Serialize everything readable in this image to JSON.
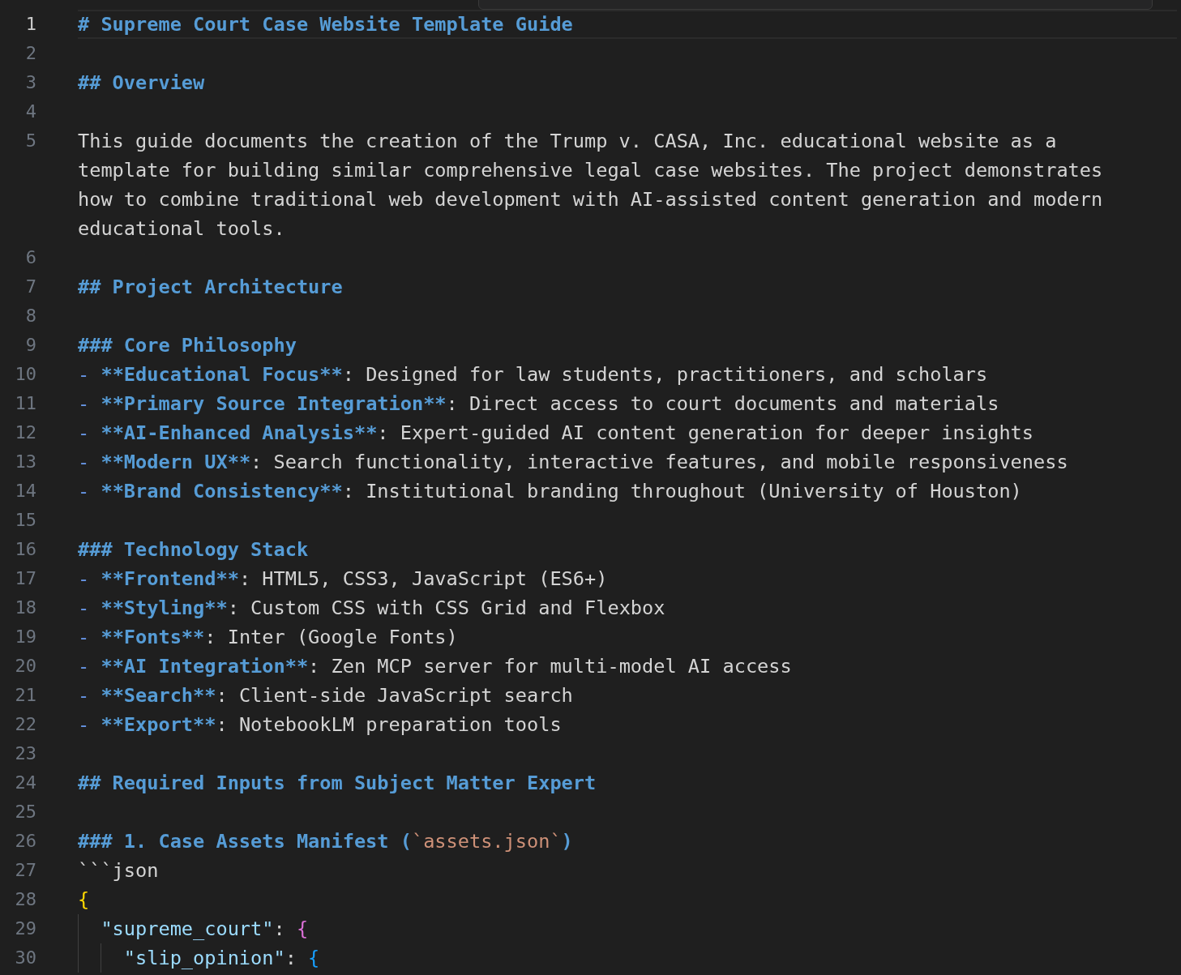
{
  "editor": {
    "lines": [
      {
        "number": "1",
        "current": true,
        "tokens": [
          {
            "kind": "heading",
            "text": "# Supreme Court Case Website Template Guide"
          }
        ]
      },
      {
        "number": "2",
        "current": false
      },
      {
        "number": "3",
        "current": false,
        "tokens": [
          {
            "kind": "heading",
            "text": "## Overview"
          }
        ]
      },
      {
        "number": "4",
        "current": false
      },
      {
        "number": "5",
        "current": false,
        "tokens": [
          {
            "kind": "plain",
            "text": "This guide documents the creation of the Trump v. CASA, Inc. educational website as a template for building similar comprehensive legal case websites. The project demonstrates how to combine traditional web development with AI-assisted content generation and modern educational tools."
          }
        ]
      },
      {
        "number": "6",
        "current": false
      },
      {
        "number": "7",
        "current": false,
        "tokens": [
          {
            "kind": "heading",
            "text": "## Project Architecture"
          }
        ]
      },
      {
        "number": "8",
        "current": false
      },
      {
        "number": "9",
        "current": false,
        "tokens": [
          {
            "kind": "heading",
            "text": "### Core Philosophy"
          }
        ]
      },
      {
        "number": "10",
        "current": false,
        "tokens": [
          {
            "kind": "bullet",
            "text": "- "
          },
          {
            "kind": "strong",
            "text": "**Educational Focus**"
          },
          {
            "kind": "plain",
            "text": ": Designed for law students, practitioners, and scholars"
          }
        ]
      },
      {
        "number": "11",
        "current": false,
        "tokens": [
          {
            "kind": "bullet",
            "text": "- "
          },
          {
            "kind": "strong",
            "text": "**Primary Source Integration**"
          },
          {
            "kind": "plain",
            "text": ": Direct access to court documents and materials"
          }
        ]
      },
      {
        "number": "12",
        "current": false,
        "tokens": [
          {
            "kind": "bullet",
            "text": "- "
          },
          {
            "kind": "strong",
            "text": "**AI-Enhanced Analysis**"
          },
          {
            "kind": "plain",
            "text": ": Expert-guided AI content generation for deeper insights"
          }
        ]
      },
      {
        "number": "13",
        "current": false,
        "tokens": [
          {
            "kind": "bullet",
            "text": "- "
          },
          {
            "kind": "strong",
            "text": "**Modern UX**"
          },
          {
            "kind": "plain",
            "text": ": Search functionality, interactive features, and mobile responsiveness"
          }
        ]
      },
      {
        "number": "14",
        "current": false,
        "tokens": [
          {
            "kind": "bullet",
            "text": "- "
          },
          {
            "kind": "strong",
            "text": "**Brand Consistency**"
          },
          {
            "kind": "plain",
            "text": ": Institutional branding throughout (University of Houston)"
          }
        ]
      },
      {
        "number": "15",
        "current": false
      },
      {
        "number": "16",
        "current": false,
        "tokens": [
          {
            "kind": "heading",
            "text": "### Technology Stack"
          }
        ]
      },
      {
        "number": "17",
        "current": false,
        "tokens": [
          {
            "kind": "bullet",
            "text": "- "
          },
          {
            "kind": "strong",
            "text": "**Frontend**"
          },
          {
            "kind": "plain",
            "text": ": HTML5, CSS3, JavaScript (ES6+)"
          }
        ]
      },
      {
        "number": "18",
        "current": false,
        "tokens": [
          {
            "kind": "bullet",
            "text": "- "
          },
          {
            "kind": "strong",
            "text": "**Styling**"
          },
          {
            "kind": "plain",
            "text": ": Custom CSS with CSS Grid and Flexbox"
          }
        ]
      },
      {
        "number": "19",
        "current": false,
        "tokens": [
          {
            "kind": "bullet",
            "text": "- "
          },
          {
            "kind": "strong",
            "text": "**Fonts**"
          },
          {
            "kind": "plain",
            "text": ": Inter (Google Fonts)"
          }
        ]
      },
      {
        "number": "20",
        "current": false,
        "tokens": [
          {
            "kind": "bullet",
            "text": "- "
          },
          {
            "kind": "strong",
            "text": "**AI Integration**"
          },
          {
            "kind": "plain",
            "text": ": Zen MCP server for multi-model AI access"
          }
        ]
      },
      {
        "number": "21",
        "current": false,
        "tokens": [
          {
            "kind": "bullet",
            "text": "- "
          },
          {
            "kind": "strong",
            "text": "**Search**"
          },
          {
            "kind": "plain",
            "text": ": Client-side JavaScript search"
          }
        ]
      },
      {
        "number": "22",
        "current": false,
        "tokens": [
          {
            "kind": "bullet",
            "text": "- "
          },
          {
            "kind": "strong",
            "text": "**Export**"
          },
          {
            "kind": "plain",
            "text": ": NotebookLM preparation tools"
          }
        ]
      },
      {
        "number": "23",
        "current": false
      },
      {
        "number": "24",
        "current": false,
        "tokens": [
          {
            "kind": "heading",
            "text": "## Required Inputs from Subject Matter Expert"
          }
        ]
      },
      {
        "number": "25",
        "current": false
      },
      {
        "number": "26",
        "current": false,
        "tokens": [
          {
            "kind": "heading",
            "text": "### 1. Case Assets Manifest ("
          },
          {
            "kind": "code",
            "text": "`assets.json`"
          },
          {
            "kind": "heading",
            "text": ")"
          }
        ]
      },
      {
        "number": "27",
        "current": false,
        "tokens": [
          {
            "kind": "plain",
            "text": "```json"
          }
        ]
      },
      {
        "number": "28",
        "current": false,
        "tokens": [
          {
            "kind": "bracket1",
            "text": "{"
          }
        ]
      },
      {
        "number": "29",
        "current": false,
        "tokens": [
          {
            "kind": "key",
            "text": "  \"supreme_court\""
          },
          {
            "kind": "plain",
            "text": ": "
          },
          {
            "kind": "bracket2",
            "text": "{"
          }
        ]
      },
      {
        "number": "30",
        "current": false,
        "tokens": [
          {
            "kind": "key",
            "text": "    \"slip_opinion\""
          },
          {
            "kind": "plain",
            "text": ": "
          },
          {
            "kind": "bracket3",
            "text": "{"
          }
        ]
      }
    ]
  }
}
